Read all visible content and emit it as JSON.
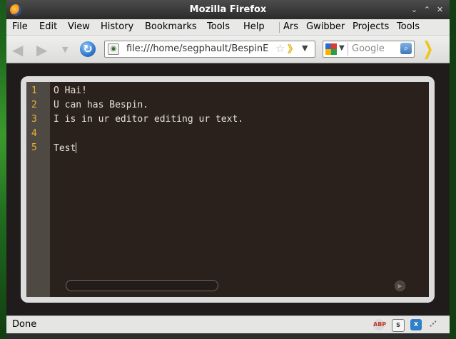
{
  "window": {
    "title": "Mozilla Firefox",
    "minimize_glyph": "⌄",
    "maximize_glyph": "⌃",
    "close_glyph": "✕"
  },
  "menu": {
    "items": [
      "File",
      "Edit",
      "View",
      "History",
      "Bookmarks",
      "Tools",
      "Help",
      "Ars",
      "Gwibber",
      "Projects",
      "Tools"
    ]
  },
  "navbar": {
    "url": "file:///home/segphault/BespinE",
    "search_placeholder": "Google",
    "back_icon": "back-arrow-icon",
    "forward_icon": "forward-arrow-icon",
    "reload_icon": "reload-icon"
  },
  "editor": {
    "line_numbers": [
      "1",
      "2",
      "3",
      "4",
      "5"
    ],
    "lines": [
      "O Hai!",
      "U can has Bespin.",
      "I is in ur editor editing ur text.",
      "",
      "Test"
    ],
    "colors": {
      "background": "#2a211c",
      "gutter": "#4e4a43",
      "line_number": "#e3b335",
      "text": "#e6e1dc"
    }
  },
  "status": {
    "text": "Done",
    "icons": [
      "abp-icon",
      "extension-icon",
      "xmarks-icon"
    ]
  },
  "icons": {
    "abp_label": "ABP",
    "ext_label": "S",
    "xmarks_label": "X"
  }
}
